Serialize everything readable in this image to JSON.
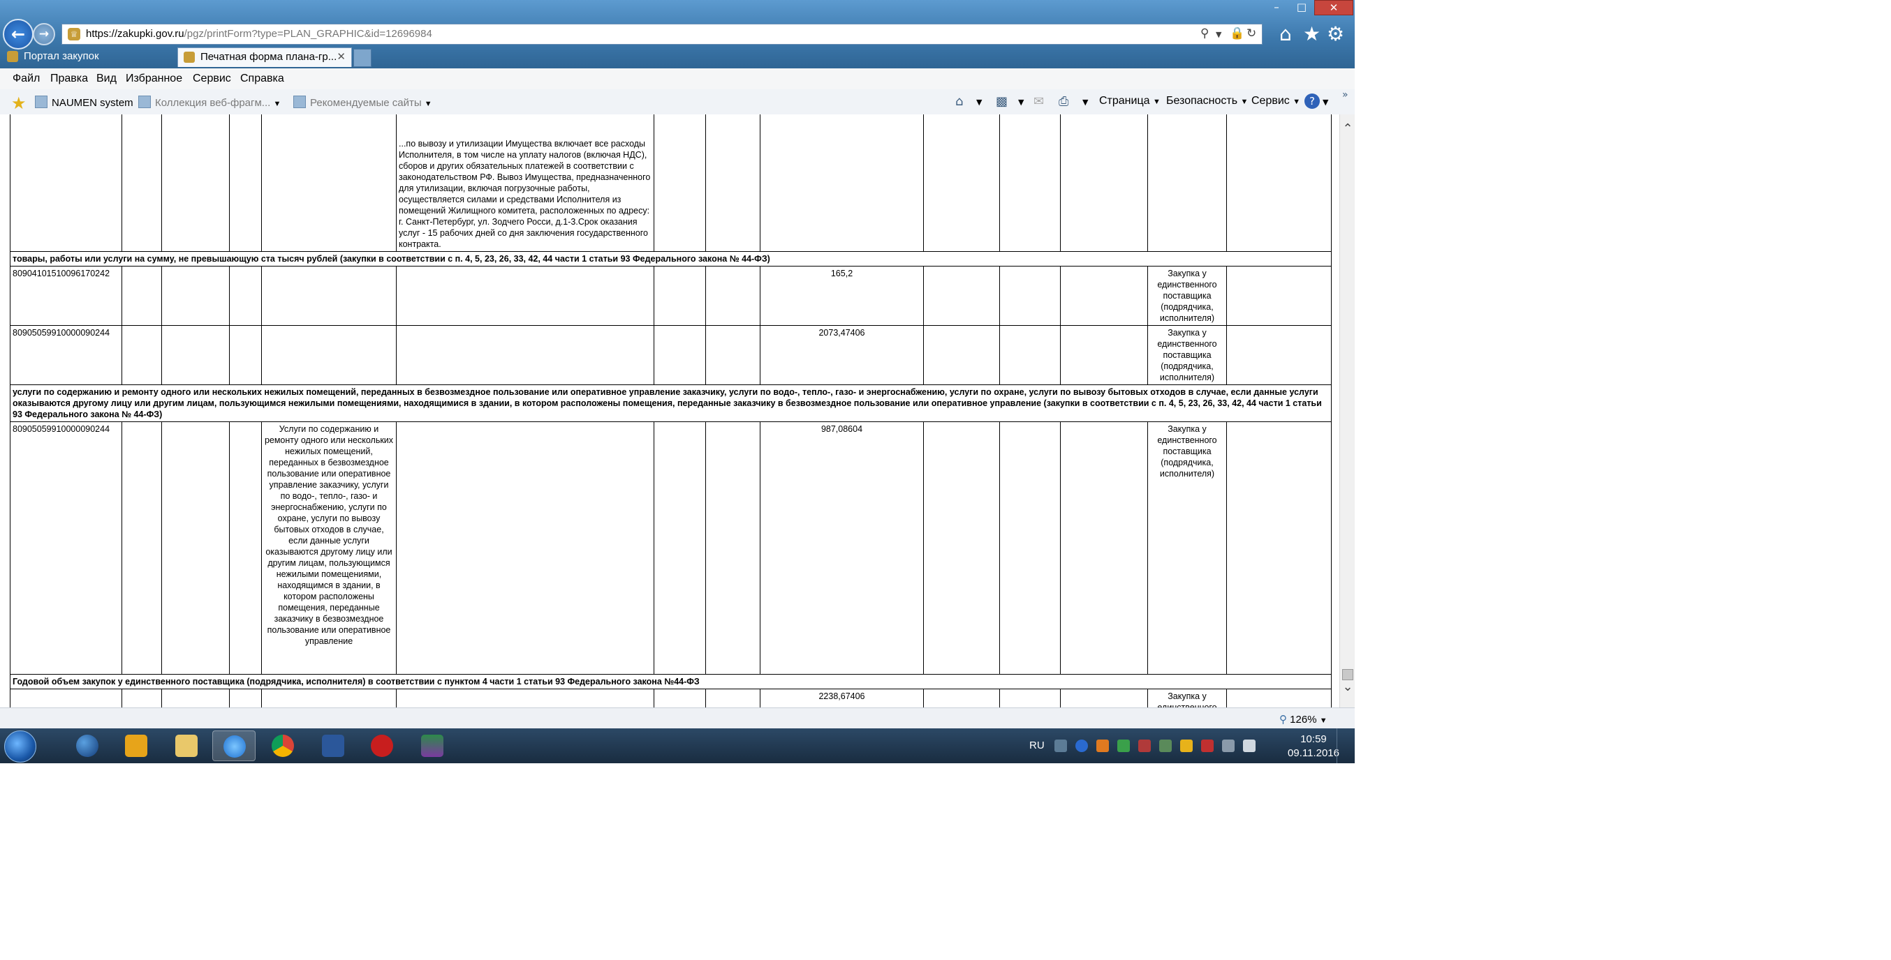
{
  "window": {
    "url_host": "https://zakupki.gov.ru",
    "url_path": "/pgz/printForm?type=PLAN_GRAPHIC&id=12696984",
    "min": "–",
    "max": "□",
    "close": "✕"
  },
  "tabs": [
    {
      "label": "Портал закупок"
    },
    {
      "label": "Печатная форма плана-гр...",
      "close": "✕"
    }
  ],
  "menu": [
    "Файл",
    "Правка",
    "Вид",
    "Избранное",
    "Сервис",
    "Справка"
  ],
  "favorites": {
    "items": [
      "NAUMEN system",
      "Коллекция веб-фрагм...",
      "Рекомендуемые сайты"
    ]
  },
  "command_bar": {
    "page": "Страница",
    "safety": "Безопасность",
    "tools": "Сервис"
  },
  "table": {
    "top_row": {
      "description": "...по вывозу и утилизации Имущества включает все расходы Исполнителя, в том числе на уплату налогов (включая НДС), сборов и других обязательных платежей в соответствии с законодательством РФ. Вывоз Имущества, предназначенного для утилизации, включая погрузочные работы, осуществляется силами и средствами Исполнителя из помещений Жилищного комитета, расположенных по адресу: г. Санкт-Петербург, ул. Зодчего Росси, д.1-3.Срок оказания услуг - 15 рабочих дней со дня заключения государственного контракта."
    },
    "group1": "товары, работы или услуги на сумму, не превышающую ста тысяч рублей (закупки в соответствии с п. 4, 5, 23, 26, 33, 42, 44 части 1 статьи 93 Федерального закона № 44-ФЗ)",
    "row1": {
      "code": "80904101510096170242",
      "amount": "165,2",
      "method": "Закупка у единственного поставщика (подрядчика, исполнителя)"
    },
    "row2": {
      "code": "80905059910000090244",
      "amount": "2073,47406",
      "method": "Закупка у единственного поставщика (подрядчика, исполнителя)"
    },
    "group2": "услуги по содержанию и ремонту одного или нескольких нежилых помещений, переданных в безвозмездное пользование или оперативное управление заказчику, услуги по водо-, тепло-, газо- и энергоснабжению, услуги по охране, услуги по вывозу бытовых отходов в случае, если данные услуги оказываются другому лицу или другим лицам, пользующимся нежилыми помещениями, находящимися в здании, в котором расположены помещения, переданные заказчику в безвозмездное пользование или оперативное управление (закупки в соответствии с п. 4, 5, 23, 26, 33, 42, 44 части 1 статьи 93 Федерального закона № 44-ФЗ)",
    "row3": {
      "code": "80905059910000090244",
      "name": "Услуги по содержанию и ремонту одного или нескольких нежилых помещений, переданных в безвозмездное пользование или оперативное управление заказчику, услуги по водо-, тепло-, газо- и энергоснабжению, услуги по охране, услуги по вывозу бытовых отходов в случае, если данные услуги оказываются другому лицу или другим лицам, пользующимся нежилыми помещениями, находящимся в здании, в котором расположены помещения, переданные заказчику в безвозмездное пользование или оперативное управление",
      "amount": "987,08604",
      "method": "Закупка у единственного поставщика (подрядчика, исполнителя)"
    },
    "group3": "Годовой объем закупок у единственного поставщика (подрядчика, исполнителя) в соответствии с пунктом 4 части 1 статьи 93 Федерального закона №44-ФЗ",
    "row4": {
      "amount": "2238,67406",
      "method": "Закупка у единственного поставщика (подрядчика, исполнителя)"
    }
  },
  "status": {
    "zoom": "126%"
  },
  "taskbar": {
    "lang": "RU",
    "time": "10:59",
    "date": "09.11.2016"
  }
}
